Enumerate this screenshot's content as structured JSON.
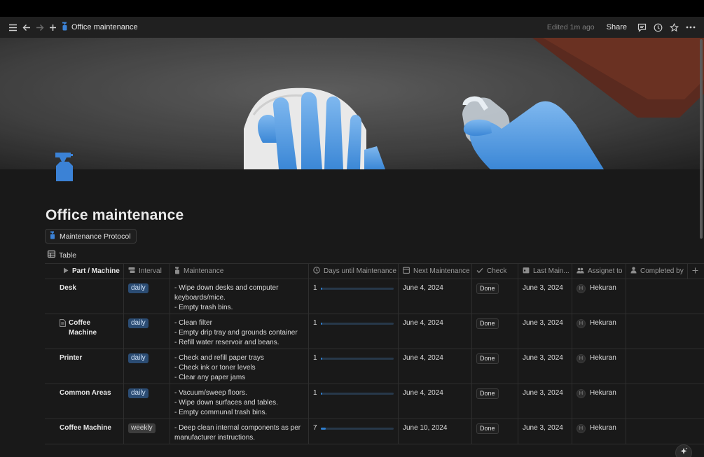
{
  "topbar": {
    "page_title": "Office maintenance",
    "edited": "Edited 1m ago",
    "share": "Share"
  },
  "page": {
    "title": "Office maintenance",
    "linked_page": "Maintenance Protocol",
    "view_tab": "Table"
  },
  "table": {
    "columns": [
      "Part / Machine",
      "Interval",
      "Maintenance",
      "Days until Maintenance",
      "Next Maintenance",
      "Check",
      "Last Main...",
      "Assignet to",
      "Completed by"
    ],
    "rows": [
      {
        "name": "Desk",
        "interval": "daily",
        "maintenance": [
          "- Wipe down desks and computer",
          "keyboards/mice.",
          "- Empty trash bins."
        ],
        "days": "1",
        "days_fraction": 0.02,
        "next": "June 4, 2024",
        "check": "Done",
        "last": "June 3, 2024",
        "avatar": "H",
        "assignee": "Hekuran"
      },
      {
        "name": "Coffee Machine",
        "interval": "daily",
        "maintenance": [
          "- Clean filter",
          "- Empty drip tray and grounds container",
          "- Refill water reservoir and beans."
        ],
        "days": "1",
        "days_fraction": 0.02,
        "next": "June 4, 2024",
        "check": "Done",
        "last": "June 3, 2024",
        "avatar": "H",
        "assignee": "Hekuran"
      },
      {
        "name": "Printer",
        "interval": "daily",
        "maintenance": [
          "- Check and refill paper trays",
          "- Check ink or toner levels",
          "- Clear any paper jams"
        ],
        "days": "1",
        "days_fraction": 0.02,
        "next": "June 4, 2024",
        "check": "Done",
        "last": "June 3, 2024",
        "avatar": "H",
        "assignee": "Hekuran"
      },
      {
        "name": "Common Areas",
        "interval": "daily",
        "maintenance": [
          "- Vacuum/sweep floors.",
          "- Wipe down surfaces and tables.",
          "- Empty communal trash bins."
        ],
        "days": "1",
        "days_fraction": 0.02,
        "next": "June 4, 2024",
        "check": "Done",
        "last": "June 3, 2024",
        "avatar": "H",
        "assignee": "Hekuran"
      },
      {
        "name": "Coffee Machine",
        "interval": "weekly",
        "maintenance": [
          "- Deep clean internal components as per",
          "manufacturer instructions."
        ],
        "days": "7",
        "days_fraction": 0.07,
        "next": "June 10, 2024",
        "check": "Done",
        "last": "June 3, 2024",
        "avatar": "H",
        "assignee": "Hekuran"
      }
    ]
  },
  "colors": {
    "background": "#191919",
    "tag_daily": "#2b4c73",
    "tag_weekly": "#3d3d3d",
    "progress": "#2f7fd0",
    "icon_blue": "#3b82d6"
  },
  "icons": [
    "menu-icon",
    "back-arrow-icon",
    "forward-arrow-icon",
    "plus-icon",
    "spray-bottle-icon",
    "comment-icon",
    "clock-icon",
    "star-icon",
    "more-icon",
    "table-icon",
    "play-icon",
    "clock-icon",
    "calendar-icon",
    "check-icon",
    "person-icon",
    "people-icon",
    "sparkle-icon",
    "document-icon"
  ]
}
